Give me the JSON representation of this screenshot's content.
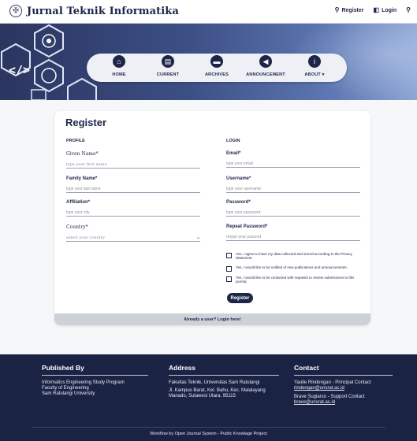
{
  "site": {
    "title": "Jurnal Teknik Informatika",
    "logo_icon": "seal-icon"
  },
  "top_links": {
    "register": "Register",
    "login": "Login"
  },
  "nav": [
    {
      "label": "HOME",
      "icon": "home-icon",
      "glyph": "⌂"
    },
    {
      "label": "CURRENT",
      "icon": "document-icon",
      "glyph": "▤"
    },
    {
      "label": "ARCHIVES",
      "icon": "archive-icon",
      "glyph": "▬"
    },
    {
      "label": "ANNOUNCEMENT",
      "icon": "megaphone-icon",
      "glyph": "◀"
    },
    {
      "label": "ABOUT ▾",
      "icon": "info-icon",
      "glyph": "i"
    }
  ],
  "form": {
    "heading": "Register",
    "profile_title": "PROFILE",
    "login_title": "LOGIN",
    "given_name": {
      "label": "Given Name*",
      "placeholder": "type your first name"
    },
    "family_name": {
      "label": "Family Name*",
      "placeholder": "type your last name"
    },
    "affiliation": {
      "label": "Affiliation*",
      "placeholder": "type your city"
    },
    "country": {
      "label": "Country*",
      "value": "select your country"
    },
    "email": {
      "label": "Email*",
      "placeholder": "type your email"
    },
    "username": {
      "label": "Username*",
      "placeholder": "type your username"
    },
    "password": {
      "label": "Password*",
      "placeholder": "type your password"
    },
    "repeat_password": {
      "label": "Repeat Password*",
      "placeholder": "retype your passord"
    },
    "checkbox_privacy": "Yes, I agree to have my data collected and stored according to the Privacy Statement.",
    "checkbox_notify": "Yes, I would like to be notified of new publications and announcements.",
    "checkbox_reviewer": "Yes, I would like to be contacted with requests to review submissions to this journal.",
    "submit": "Register",
    "login_prompt": "Already a user? Login here!"
  },
  "footer": {
    "published_title": "Published By",
    "published_lines": [
      "Informatics Engineering Study Program",
      "Faculty of Engineering",
      "Sam Ratulangi University"
    ],
    "address_title": "Address",
    "address_lines": [
      "Fakultas Teknik, Universitas Sam Ratulangi",
      "Jl. Kampus Barat, Kel. Bahu, Kec. Malalayang",
      "Manado, Sulawesi Utara, 95115"
    ],
    "contact_title": "Contact",
    "contact_1": "Yaulie Rindengan - Principal Contact",
    "contact_1_email": "rindengan@unsrat.ac.id",
    "contact_2": "Brave Sugiarso - Support Contact",
    "contact_2_email": "brave@unsrat.ac.id",
    "credit": "Workflow by Open Journal System - Public Knowlage Project"
  }
}
